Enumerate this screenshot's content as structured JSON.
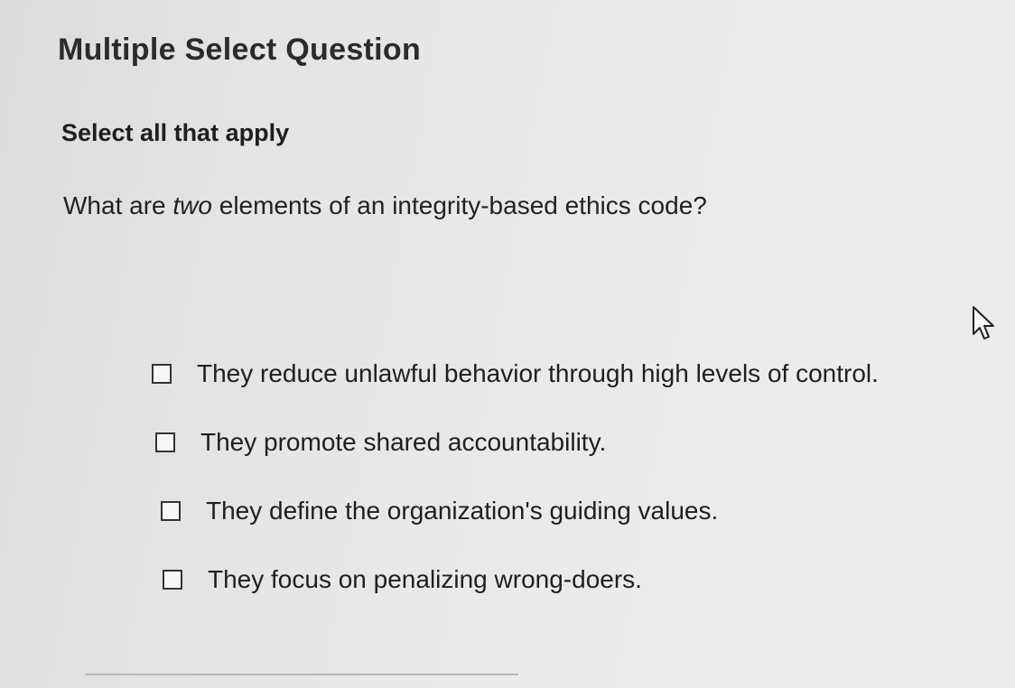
{
  "question": {
    "type_label": "Multiple Select Question",
    "instruction": "Select all that apply",
    "prompt_before": "What are ",
    "prompt_emphasis": "two",
    "prompt_after": " elements of an integrity-based ethics code?"
  },
  "options": [
    {
      "label": "They reduce unlawful behavior through high levels of control.",
      "checked": false
    },
    {
      "label": "They promote shared accountability.",
      "checked": false
    },
    {
      "label": "They define the organization's guiding values.",
      "checked": false
    },
    {
      "label": "They focus on penalizing wrong-doers.",
      "checked": false
    }
  ],
  "icons": {
    "checkbox": "checkbox-empty-icon",
    "cursor": "mouse-pointer-icon"
  }
}
